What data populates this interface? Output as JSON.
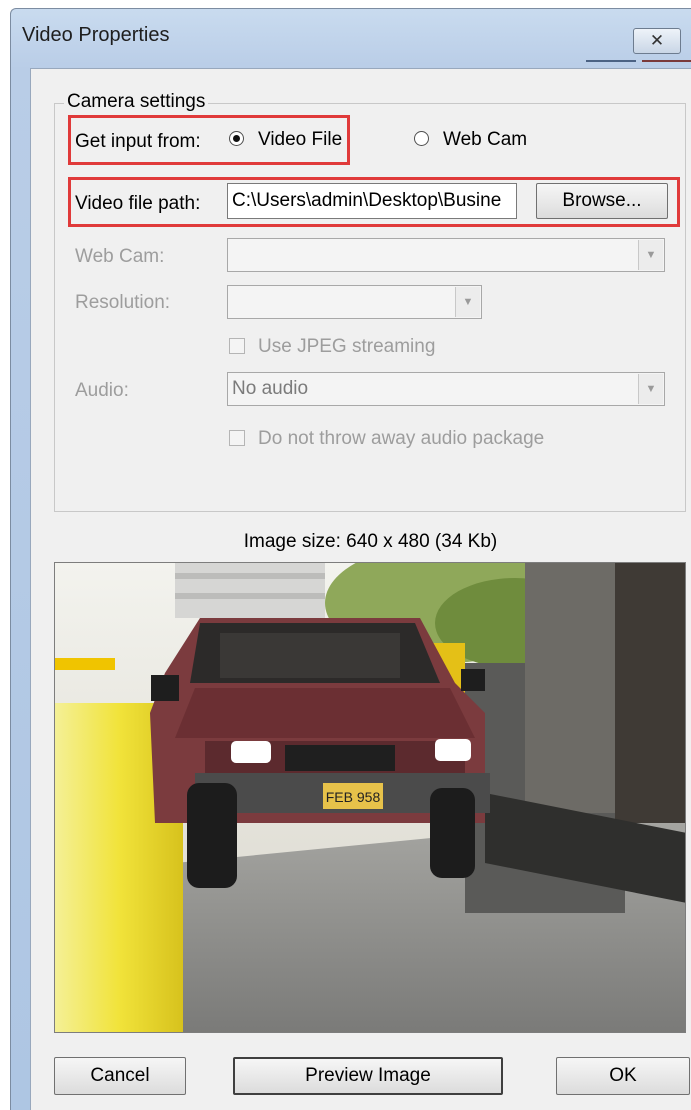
{
  "window": {
    "title": "Video Properties",
    "close_glyph": "✕"
  },
  "camera_settings": {
    "legend": "Camera settings",
    "get_input_label": "Get input from:",
    "radio_video_file": "Video File",
    "radio_web_cam": "Web Cam",
    "selected_input": "Video File",
    "video_path_label": "Video file path:",
    "video_path_value": "C:\\Users\\admin\\Desktop\\Busine",
    "browse_label": "Browse...",
    "webcam_label": "Web Cam:",
    "webcam_value": "",
    "resolution_label": "Resolution:",
    "resolution_value": "",
    "jpeg_label": "Use JPEG streaming",
    "audio_label": "Audio:",
    "audio_value": "No audio",
    "audio_package_label": "Do not throw away audio package",
    "highlight_color": "#e03a3a"
  },
  "image_size_text": "Image size: 640 x 480 (34 Kb)",
  "preview": {
    "plate_text": "FEB 958"
  },
  "buttons": {
    "cancel": "Cancel",
    "preview": "Preview Image",
    "ok": "OK"
  },
  "icons": {
    "close": "close-icon",
    "dropdown": "chevron-down-icon"
  }
}
